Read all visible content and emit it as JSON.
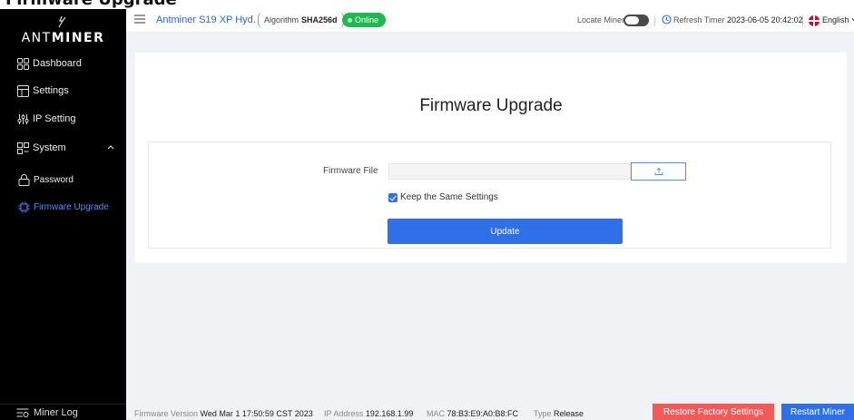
{
  "top_strip": {
    "cropped_title": "Firmware Upgrade"
  },
  "sidebar": {
    "brand_prefix": "ANT",
    "brand_suffix": "MINER",
    "items": [
      {
        "label": "Dashboard",
        "icon": "grid-icon"
      },
      {
        "label": "Settings",
        "icon": "settings-icon"
      },
      {
        "label": "IP Setting",
        "icon": "network-icon"
      },
      {
        "label": "System",
        "icon": "system-icon"
      },
      {
        "label": "Password",
        "icon": "lock-icon"
      },
      {
        "label": "Firmware Upgrade",
        "icon": "chip-icon",
        "active": true
      }
    ],
    "miner_log": "Miner Log"
  },
  "header": {
    "model": "Antminer S19 XP Hyd.",
    "algorithm_label": "Algorithm",
    "algorithm_value": "SHA256d",
    "status": "Online",
    "locate_miner": "Locate Miner",
    "refresh_label": "Refresh Timer",
    "refresh_value": "2023-06-05 20:42:02",
    "language": "English"
  },
  "main": {
    "title": "Firmware Upgrade",
    "firmware_file_label": "Firmware File",
    "keep_settings_label": "Keep the Same Settings",
    "update_label": "Update"
  },
  "footer": {
    "fw_version_label": "Firmware Version",
    "fw_version_value": "Wed Mar 1 17:50:59 CST 2023",
    "ip_label": "IP Address",
    "ip_value": "192.168.1.99",
    "mac_label": "MAC",
    "mac_value": "78:B3:E9:A0:B8:FC",
    "type_label": "Type",
    "type_value": "Release",
    "restore_label": "Restore Factory Settings",
    "restart_label": "Restart Miner"
  },
  "colors": {
    "accent_blue": "#2f6fe8",
    "online_green": "#1fb851",
    "danger_red": "#f25a5a",
    "sidebar_bg": "#000000"
  }
}
